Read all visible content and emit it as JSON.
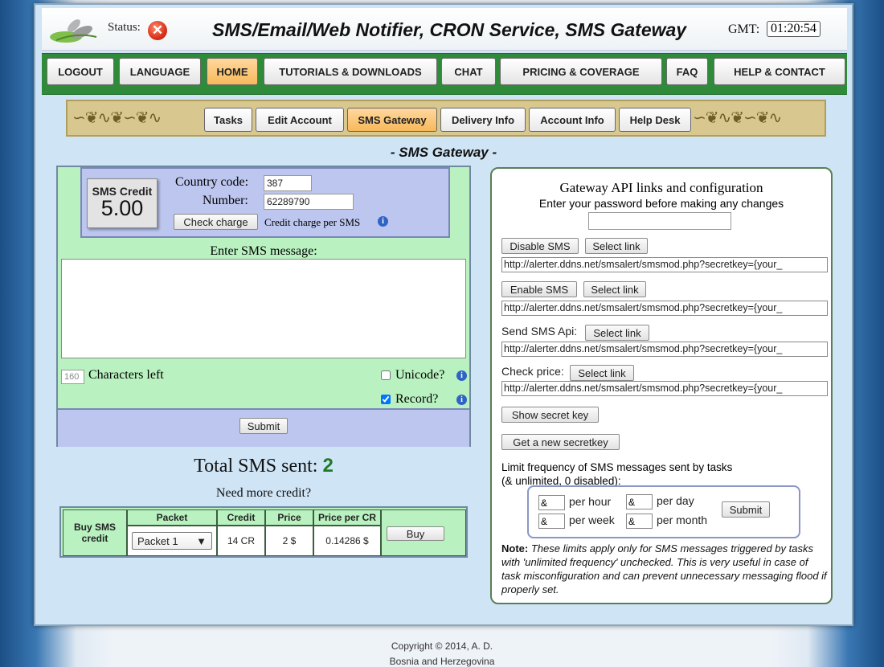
{
  "header": {
    "status_label": "Status:",
    "status_icon": "error-x-icon",
    "title": "SMS/Email/Web Notifier, CRON Service, SMS Gateway",
    "gmt_label": "GMT:",
    "gmt_time": "01:20:54"
  },
  "main_nav": [
    {
      "label": "LOGOUT",
      "active": false
    },
    {
      "label": "LANGUAGE",
      "active": false
    },
    {
      "label": "HOME",
      "active": true
    },
    {
      "label": "TUTORIALS & DOWNLOADS",
      "active": false
    },
    {
      "label": "CHAT",
      "active": false
    },
    {
      "label": "PRICING & COVERAGE",
      "active": false
    },
    {
      "label": "FAQ",
      "active": false
    },
    {
      "label": "HELP & CONTACT",
      "active": false
    }
  ],
  "sub_nav": [
    {
      "label": "Tasks",
      "active": false
    },
    {
      "label": "Edit Account",
      "active": false
    },
    {
      "label": "SMS Gateway",
      "active": true
    },
    {
      "label": "Delivery Info",
      "active": false
    },
    {
      "label": "Account Info",
      "active": false
    },
    {
      "label": "Help Desk",
      "active": false
    }
  ],
  "section_title": "- SMS Gateway -",
  "sms_form": {
    "credit_label": "SMS Credit",
    "credit_value": "5.00",
    "country_code_label": "Country code:",
    "country_code_value": "387",
    "number_label": "Number:",
    "number_value": "62289790",
    "check_charge_button": "Check charge",
    "credit_charge_text": "Credit charge per SMS",
    "enter_message_label": "Enter SMS message:",
    "message_value": "",
    "chars_left_value": "160",
    "chars_left_label": "Characters left",
    "unicode_label": "Unicode?",
    "unicode_checked": false,
    "record_label": "Record?",
    "record_checked": true,
    "submit_button": "Submit"
  },
  "totals": {
    "total_label": "Total SMS sent:",
    "total_value": "2",
    "need_more": "Need more credit?"
  },
  "buy_table": {
    "row_label": "Buy SMS credit",
    "headers": [
      "Packet",
      "Credit",
      "Price",
      "Price per CR"
    ],
    "packet_selected": "Packet 1",
    "credit": "14 CR",
    "price": "2 $",
    "price_per_cr": "0.14286 $",
    "buy_button": "Buy"
  },
  "api_panel": {
    "title": "Gateway API links and configuration",
    "subtitle": "Enter your password before making any changes",
    "password_value": "",
    "disable_sms_button": "Disable SMS",
    "enable_sms_button": "Enable SMS",
    "select_link_button": "Select link",
    "send_sms_label": "Send SMS Api:",
    "check_price_label": "Check price:",
    "url_disable": "http://alerter.ddns.net/smsalert/smsmod.php?secretkey={your_",
    "url_enable": "http://alerter.ddns.net/smsalert/smsmod.php?secretkey={your_",
    "url_send": "http://alerter.ddns.net/smsalert/smsmod.php?secretkey={your_",
    "url_price": "http://alerter.ddns.net/smsalert/smsmod.php?secretkey={your_",
    "show_secret_button": "Show secret key",
    "new_secret_button": "Get a new secretkey",
    "limit_title": "Limit frequency of SMS messages sent by tasks",
    "limit_subtitle": "(& unlimited, 0 disabled):",
    "per_hour_value": "&",
    "per_hour_label": "per hour",
    "per_day_value": "&",
    "per_day_label": "per day",
    "per_week_value": "&",
    "per_week_label": "per week",
    "per_month_value": "&",
    "per_month_label": "per month",
    "limit_submit": "Submit",
    "note_label": "Note:",
    "note_text": "These limits apply only for SMS messages triggered by tasks with 'unlimited frequency' unchecked. This is very useful in case of task misconfiguration and can prevent unnecessary messaging flood if properly set."
  },
  "footer": {
    "copyright": "Copyright © 2014, A. D.",
    "location": "Bosnia and Herzegovina"
  }
}
